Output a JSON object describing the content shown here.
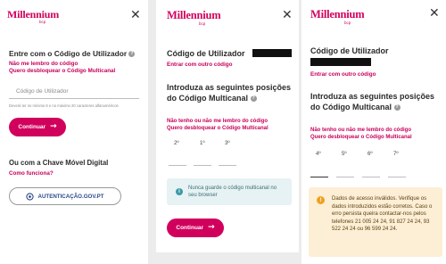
{
  "panel1": {
    "logo": "Millennium",
    "logo_sub": "bcp",
    "heading": "Entre com o Código de Utilizador",
    "link_forgot": "Não me lembro do código",
    "link_unlock": "Quero desbloquear o Código Multicanal",
    "input_placeholder": "Código de Utilizador",
    "hint": "Deverá ter no mínimo 6 e no máximo 20 caracteres alfanuméricos",
    "continue_label": "Continuar",
    "alt_heading": "Ou com a Chave Móvel Digital",
    "how_link": "Como funciona?",
    "gov_button": "AUTENTICAÇÃO.GOV.PT"
  },
  "panel2": {
    "logo": "Millennium",
    "logo_sub": "bcp",
    "heading": "Código de Utilizador",
    "link_other": "Entrar com outro código",
    "positions_heading": "Introduza as seguintes posições do Código Multicanal",
    "link_forgot": "Não tenho ou não me lembro do código",
    "link_unlock": "Quero desbloquear o Código Multicanal",
    "positions": [
      "2º",
      "1º",
      "3º"
    ],
    "info_text": "Nunca guarde o código multicanal no seu browser",
    "continue_label": "Continuar"
  },
  "panel3": {
    "logo": "Millennium",
    "logo_sub": "bcp",
    "heading": "Código de Utilizador",
    "link_other": "Entrar com outro código",
    "positions_heading": "Introduza as seguintes posições do Código Multicanal",
    "link_forgot": "Não tenho ou não me lembro do código",
    "link_unlock": "Quero desbloquear o Código Multicanal",
    "positions": [
      "4º",
      "5º",
      "6º",
      "7º"
    ],
    "error_text": "Dados de acesso inválidos. Verifique os dados introduzidos estão corretos. Caso o erro persista queira contactar-nos pelos telefones 21 005 24 24, 91 827 24 24, 93 522 24 24 ou 96 599 24 24."
  },
  "colors": {
    "brand": "#d1005d",
    "info_bg": "#e6f2f4",
    "warning_bg": "#fdeed6"
  },
  "icons": {
    "close": "close-icon",
    "help": "help-icon",
    "arrow": "arrow-right-icon",
    "info": "info-icon",
    "warning": "warning-icon",
    "gov": "gov-pt-icon"
  }
}
